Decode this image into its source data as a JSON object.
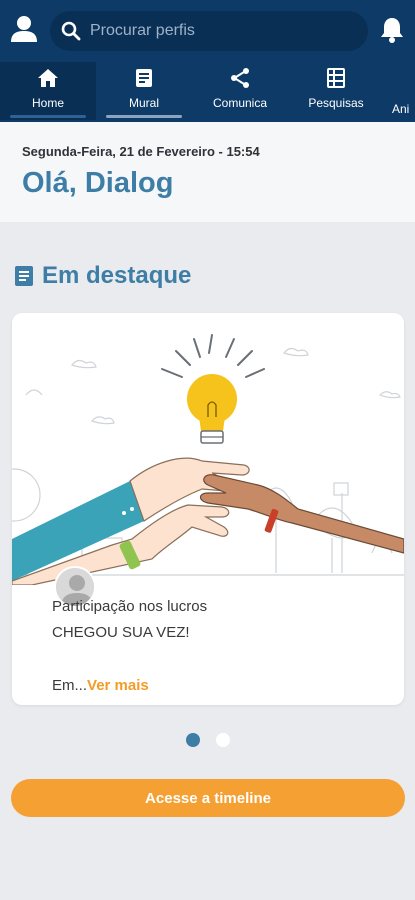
{
  "header": {
    "search_placeholder": "Procurar perfis"
  },
  "tabs": [
    {
      "label": "Home",
      "icon": "home-icon"
    },
    {
      "label": "Mural",
      "icon": "news-icon"
    },
    {
      "label": "Comunica",
      "icon": "share-icon"
    },
    {
      "label": "Pesquisas",
      "icon": "grid-icon"
    },
    {
      "label": "Ani",
      "icon": "partial-icon"
    }
  ],
  "greeting": {
    "date": "Segunda-Feira, 21 de Fevereiro - 15:54",
    "hello": "Olá, Dialog"
  },
  "featured": {
    "title": "Em destaque",
    "card": {
      "title": "Participação nos lucros",
      "subtitle": "CHEGOU SUA VEZ!",
      "excerpt": "Em...",
      "more_label": "Ver mais"
    }
  },
  "carousel": {
    "count": 2,
    "active": 0
  },
  "cta_label": "Acesse a timeline",
  "colors": {
    "header_bg": "#0d3a66",
    "accent_blue": "#3e7ea6",
    "accent_orange": "#f5a033"
  }
}
